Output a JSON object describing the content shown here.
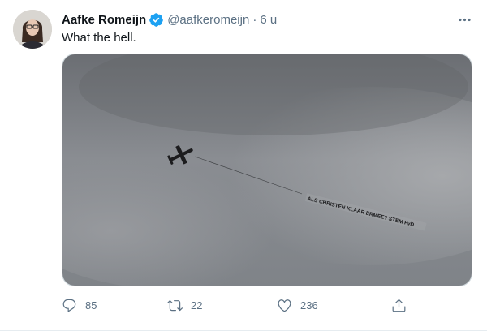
{
  "tweet": {
    "author": {
      "display_name": "Aafke Romeijn",
      "verified": true,
      "handle": "@aafkeromeijn",
      "separator": "·",
      "time": "6 u"
    },
    "text": "What the hell.",
    "media": {
      "banner_text": "ALS CHRISTEN KLAAR ERMEE? STEM FvD"
    },
    "actions": {
      "reply_count": "85",
      "retweet_count": "22",
      "like_count": "236"
    },
    "icons": {
      "verified": "verified-badge-icon",
      "more": "more-icon",
      "reply": "reply-icon",
      "retweet": "retweet-icon",
      "like": "heart-icon",
      "share": "share-icon"
    },
    "colors": {
      "verified": "#1da1f2",
      "secondary_text": "#5b7083",
      "primary_text": "#0f1419"
    }
  }
}
